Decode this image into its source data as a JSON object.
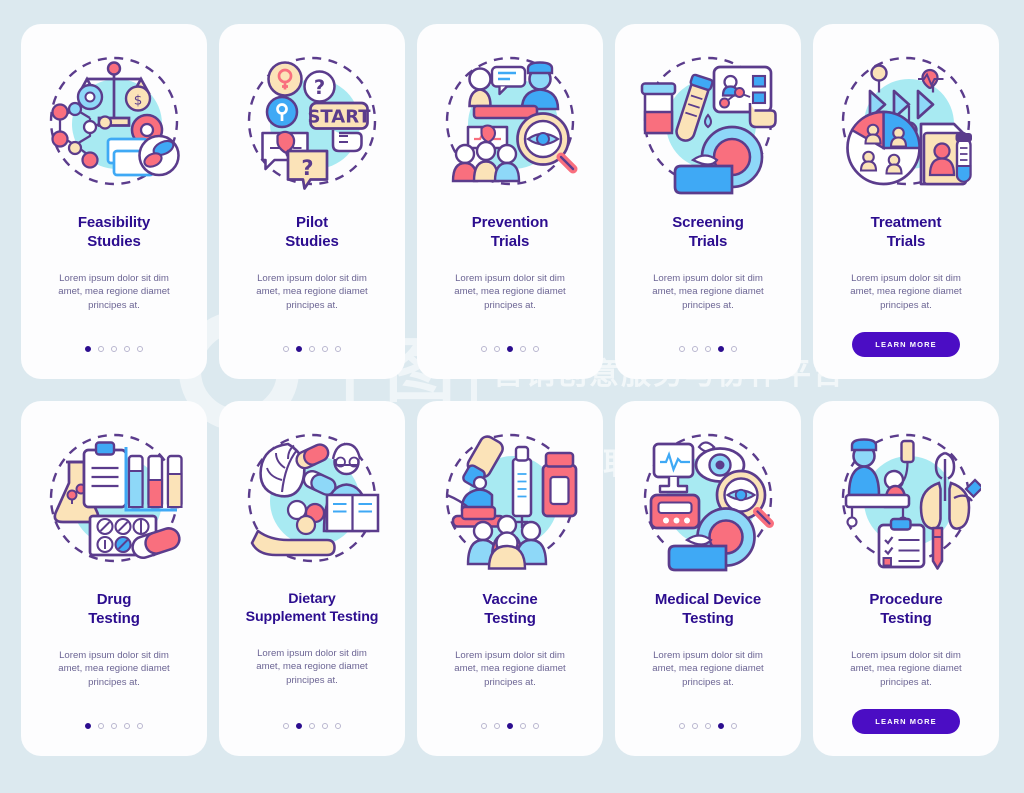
{
  "palette": {
    "background": "#dce9ef",
    "card": "#fdfdfe",
    "title": "#2c0d8f",
    "body_text": "#6c6594",
    "dot_active": "#2c0d8f",
    "dot_inactive": "#b9b6cf",
    "button_bg": "#4b0dc4",
    "button_text": "#ffffff",
    "accent_blue": "#3fa9f5",
    "accent_pink": "#f96f7e",
    "accent_cream": "#fbe3b8",
    "accent_cyan": "#a8eaf2",
    "outline": "#5b3c8c"
  },
  "watermark": {
    "logo_glyph": "千图",
    "line1": "营销创意服务与协作平台",
    "line2": "商用请获取授权"
  },
  "button": {
    "learn_more_label": "LEARN MORE"
  },
  "shared": {
    "description": "Lorem ipsum dolor sit dim amet, mea regione diamet principes at."
  },
  "cards": [
    {
      "id": "feasibility-studies",
      "title_line1": "Feasibility",
      "title_line2": "Studies",
      "icon": "scales-dna-gear-pills-icon",
      "description": "Lorem ipsum dolor sit dim amet, mea regione diamet principes at.",
      "footer": "dots",
      "dots_total": 5,
      "dot_active": 1
    },
    {
      "id": "pilot-studies",
      "title_line1": "Pilot",
      "title_line2": "Studies",
      "icon": "start-button-question-chat-icon",
      "description": "Lorem ipsum dolor sit dim amet, mea regione diamet principes at.",
      "footer": "dots",
      "dots_total": 5,
      "dot_active": 2
    },
    {
      "id": "prevention-trials",
      "title_line1": "Prevention",
      "title_line2": "Trials",
      "icon": "doctor-patient-magnifier-eye-icon",
      "description": "Lorem ipsum dolor sit dim amet, mea regione diamet principes at.",
      "footer": "dots",
      "dots_total": 5,
      "dot_active": 3
    },
    {
      "id": "screening-trials",
      "title_line1": "Screening",
      "title_line2": "Trials",
      "icon": "samples-mri-scan-data-icon",
      "description": "Lorem ipsum dolor sit dim amet, mea regione diamet principes at.",
      "footer": "dots",
      "dots_total": 5,
      "dot_active": 4
    },
    {
      "id": "treatment-trials",
      "title_line1": "Treatment",
      "title_line2": "Trials",
      "icon": "pie-chart-patients-record-vial-icon",
      "description": "Lorem ipsum dolor sit dim amet, mea regione diamet principes at.",
      "footer": "button",
      "button_label": "LEARN MORE"
    },
    {
      "id": "drug-testing",
      "title_line1": "Drug",
      "title_line2": "Testing",
      "icon": "flask-clipboard-testtubes-pills-icon",
      "description": "Lorem ipsum dolor sit dim amet, mea regione diamet principes at.",
      "footer": "dots",
      "dots_total": 5,
      "dot_active": 1
    },
    {
      "id": "dietary-supplement-testing",
      "title_line1": "Dietary",
      "title_line2": "Supplement Testing",
      "icon": "herbs-capsules-doctor-hand-icon",
      "description": "Lorem ipsum dolor sit dim amet, mea regione diamet principes at.",
      "footer": "dots",
      "dots_total": 5,
      "dot_active": 2
    },
    {
      "id": "vaccine-testing",
      "title_line1": "Vaccine",
      "title_line2": "Testing",
      "icon": "microscope-syringe-vial-people-icon",
      "description": "Lorem ipsum dolor sit dim amet, mea regione diamet principes at.",
      "footer": "dots",
      "dots_total": 5,
      "dot_active": 3
    },
    {
      "id": "medical-device-testing",
      "title_line1": "Medical Device",
      "title_line2": "Testing",
      "icon": "monitor-eye-magnifier-mri-icon",
      "description": "Lorem ipsum dolor sit dim amet, mea regione diamet principes at.",
      "footer": "dots",
      "dots_total": 5,
      "dot_active": 4
    },
    {
      "id": "procedure-testing",
      "title_line1": "Procedure",
      "title_line2": "Testing",
      "icon": "surgery-lungs-checklist-icon",
      "description": "Lorem ipsum dolor sit dim amet, mea regione diamet principes at.",
      "footer": "button",
      "button_label": "LEARN MORE"
    }
  ]
}
